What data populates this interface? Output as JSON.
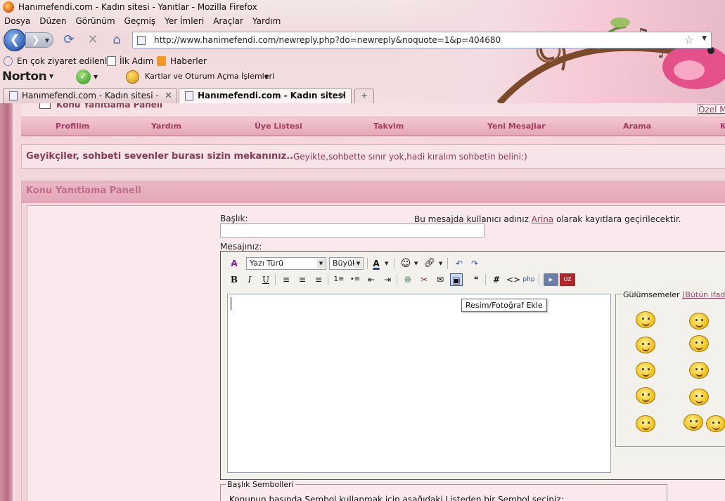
{
  "window": {
    "title": "Hanımefendi.com - Kadın sitesi - Yanıtlar - Mozilla Firefox"
  },
  "menu": [
    "Dosya",
    "Düzen",
    "Görünüm",
    "Geçmiş",
    "Yer İmleri",
    "Araçlar",
    "Yardım"
  ],
  "address": {
    "url": "http://www.hanimefendi.com/newreply.php?do=newreply&noquote=1&p=404680"
  },
  "bookmarks": {
    "most_visited": "En çok ziyaret edilenler",
    "first_step": "İlk Adım",
    "news": "Haberler"
  },
  "norton": {
    "logo": "Norton",
    "cards_link": "Kartlar ve Oturum Açma İşlemleri"
  },
  "tabs": [
    {
      "label": "Hanımefendi.com - Kadın sitesi - Ki...",
      "active": false
    },
    {
      "label": "Hanımefendi.com - Kadın sitesi - ...",
      "active": true
    }
  ],
  "page": {
    "header_title": "Konu Yanıtlama Paneli",
    "private_messages": "Özel Mesaj",
    "nav": [
      "Profilim",
      "Yardım",
      "Üye Listesi",
      "Takvim",
      "Yeni Mesajlar",
      "Arama",
      "K"
    ],
    "announcement": {
      "bold": "Geyikçiler, sohbeti sevenler burası sizin mekanınız..",
      "normal": "Geyikte,sohbette sınır yok,hadi kıralım sohbetin belini:)"
    },
    "panel_title": "Konu Yanıtlama Paneli",
    "form": {
      "title_label": "Başlık:",
      "title_value": "",
      "note_before": "Bu mesajda kullanıcı adınız",
      "username": "Arina",
      "note_after": "olarak kayıtlara geçirilecektir.",
      "message_label": "Mesajınız:",
      "font_select": "Yazı Türü",
      "size_select": "Büyük",
      "tooltip": "Resim/Fotoğraf Ekle",
      "smilies_title": "Gülümsemeler",
      "smilies_all": "[Bütün ifadeleri",
      "symbols_legend": "Başlık Sembolleri",
      "symbols_text": "Konunun başında Sembol kullanmak için aşağıdaki Listeden bir Sembol seçiniz:"
    }
  },
  "colors": {
    "accent": "#a23c62",
    "panel_head": "#e3a7b7",
    "page_bg": "#f4d7dd"
  }
}
